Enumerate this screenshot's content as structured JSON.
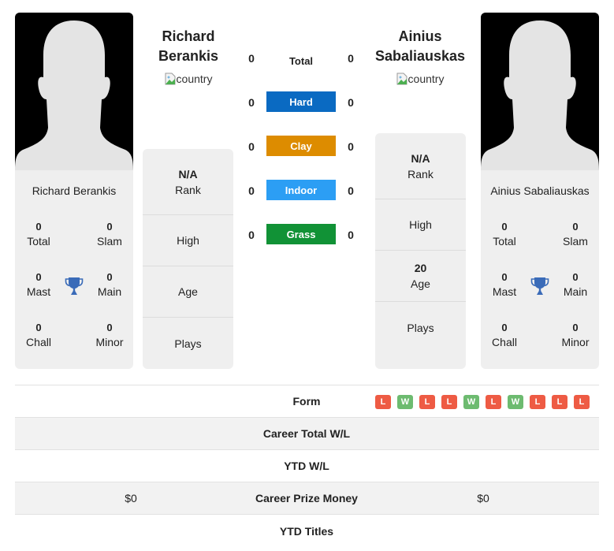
{
  "players": {
    "left": {
      "name": "Richard Berankis",
      "name_line1": "Richard",
      "name_line2": "Berankis",
      "country_alt": "country",
      "titles": {
        "total": {
          "value": "0",
          "label": "Total"
        },
        "slam": {
          "value": "0",
          "label": "Slam"
        },
        "mast": {
          "value": "0",
          "label": "Mast"
        },
        "main": {
          "value": "0",
          "label": "Main"
        },
        "chall": {
          "value": "0",
          "label": "Chall"
        },
        "minor": {
          "value": "0",
          "label": "Minor"
        }
      },
      "info": {
        "rank": {
          "value": "N/A",
          "label": "Rank"
        },
        "high": {
          "value": "",
          "label": "High"
        },
        "age": {
          "value": "",
          "label": "Age"
        },
        "plays": {
          "value": "",
          "label": "Plays"
        }
      }
    },
    "right": {
      "name": "Ainius Sabaliauskas",
      "name_line1": "Ainius",
      "name_line2": "Sabaliauskas",
      "country_alt": "country",
      "titles": {
        "total": {
          "value": "0",
          "label": "Total"
        },
        "slam": {
          "value": "0",
          "label": "Slam"
        },
        "mast": {
          "value": "0",
          "label": "Mast"
        },
        "main": {
          "value": "0",
          "label": "Main"
        },
        "chall": {
          "value": "0",
          "label": "Chall"
        },
        "minor": {
          "value": "0",
          "label": "Minor"
        }
      },
      "info": {
        "rank": {
          "value": "N/A",
          "label": "Rank"
        },
        "high": {
          "value": "",
          "label": "High"
        },
        "age": {
          "value": "20",
          "label": "Age"
        },
        "plays": {
          "value": "",
          "label": "Plays"
        }
      }
    }
  },
  "h2h": [
    {
      "label": "Total",
      "left": "0",
      "right": "0",
      "color": ""
    },
    {
      "label": "Hard",
      "left": "0",
      "right": "0",
      "color": "#0a6ac2"
    },
    {
      "label": "Clay",
      "left": "0",
      "right": "0",
      "color": "#dd8c00"
    },
    {
      "label": "Indoor",
      "left": "0",
      "right": "0",
      "color": "#2c9ef4"
    },
    {
      "label": "Grass",
      "left": "0",
      "right": "0",
      "color": "#119236"
    }
  ],
  "comparison": {
    "form": {
      "label": "Form",
      "results": [
        "L",
        "W",
        "L",
        "L",
        "W",
        "L",
        "W",
        "L",
        "L",
        "L"
      ]
    },
    "career_wl": {
      "label": "Career Total W/L",
      "left": "",
      "right": ""
    },
    "ytd_wl": {
      "label": "YTD W/L",
      "left": "",
      "right": ""
    },
    "prize_money": {
      "label": "Career Prize Money",
      "left": "$0",
      "right": "$0"
    },
    "ytd_titles": {
      "label": "YTD Titles",
      "left": "",
      "right": ""
    }
  },
  "colors": {
    "win": "#6dbb70",
    "loss": "#ee5b44",
    "trophy": "#3a6bb8"
  }
}
